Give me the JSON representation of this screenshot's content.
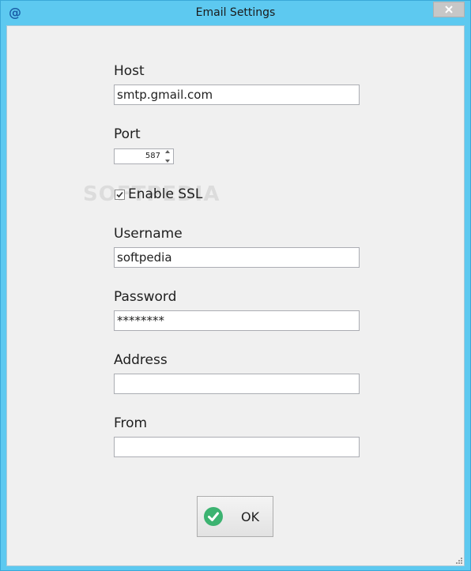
{
  "window": {
    "title": "Email Settings",
    "app_icon": "at-sign-icon",
    "accent": "#5dc9f0"
  },
  "form": {
    "host_label": "Host",
    "host_value": "smtp.gmail.com",
    "port_label": "Port",
    "port_value": "587",
    "ssl_label": "Enable SSL",
    "ssl_checked": true,
    "username_label": "Username",
    "username_value": "softpedia",
    "password_label": "Password",
    "password_value": "********",
    "address_label": "Address",
    "address_value": "",
    "from_label": "From",
    "from_value": ""
  },
  "buttons": {
    "ok_label": "OK",
    "ok_icon": "check-circle-icon",
    "ok_icon_color": "#3cb371"
  },
  "watermark": "SOFTPEDIA"
}
